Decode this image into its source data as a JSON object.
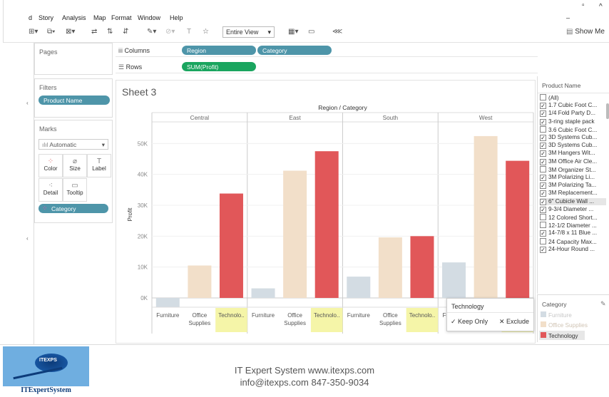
{
  "menu": [
    "d",
    "Story",
    "Analysis",
    "Map",
    "Format",
    "Window",
    "Help"
  ],
  "toolbar": {
    "fit_select": "Entire View",
    "show_me": "Show Me"
  },
  "pages": {
    "title": "Pages"
  },
  "filters": {
    "title": "Filters",
    "pill": "Product Name"
  },
  "marks": {
    "title": "Marks",
    "type": "Automatic",
    "buttons": [
      "Color",
      "Size",
      "Label",
      "Detail",
      "Tooltip"
    ],
    "pill": "Category"
  },
  "shelves": {
    "columns_label": "Columns",
    "rows_label": "Rows",
    "columns": [
      "Region",
      "Category"
    ],
    "rows": [
      "SUM(Profit)"
    ]
  },
  "sheet": {
    "title": "Sheet 3"
  },
  "chart_data": {
    "type": "bar",
    "header": "Region / Category",
    "regions": [
      "Central",
      "East",
      "South",
      "West"
    ],
    "categories": [
      "Furniture",
      "Office Supplies",
      "Technolo.."
    ],
    "category_tick_lines": [
      [
        "Furniture"
      ],
      [
        "Office",
        "Supplies"
      ],
      [
        "Technolo.."
      ]
    ],
    "ylabel": "Profit",
    "yticks": [
      "0K",
      "10K",
      "20K",
      "30K",
      "40K",
      "50K"
    ],
    "ylim": [
      -3000,
      57000
    ],
    "series": [
      {
        "region": "Central",
        "values": [
          -2900,
          10500,
          33800
        ]
      },
      {
        "region": "East",
        "values": [
          3100,
          41200,
          47500
        ]
      },
      {
        "region": "South",
        "values": [
          6900,
          19600,
          20000
        ]
      },
      {
        "region": "West",
        "values": [
          11500,
          52400,
          44400
        ]
      }
    ],
    "colors": {
      "Furniture": "#d3dce3",
      "Office Supplies": "#f2dfc9",
      "Technology": "#e15759"
    },
    "highlight": "#f5f5a8"
  },
  "product_list": {
    "title": "Product Name",
    "items": [
      {
        "label": "(All)",
        "checked": false
      },
      {
        "label": "1.7 Cubic Foot C...",
        "checked": true
      },
      {
        "label": "1/4 Fold Party D...",
        "checked": true
      },
      {
        "label": "3-ring staple pack",
        "checked": true
      },
      {
        "label": "3.6 Cubic Foot C...",
        "checked": false
      },
      {
        "label": "3D Systems Cub...",
        "checked": true
      },
      {
        "label": "3D Systems Cub...",
        "checked": true
      },
      {
        "label": "3M Hangers Wit...",
        "checked": true
      },
      {
        "label": "3M Office Air Cle...",
        "checked": true
      },
      {
        "label": "3M Organizer St...",
        "checked": false
      },
      {
        "label": "3M Polarizing Li...",
        "checked": true
      },
      {
        "label": "3M Polarizing Ta...",
        "checked": true
      },
      {
        "label": "3M Replacement...",
        "checked": true
      },
      {
        "label": "6\" Cubicle Wall ...",
        "checked": true
      },
      {
        "label": "9-3/4 Diameter ...",
        "checked": true
      },
      {
        "label": "12 Colored Short...",
        "checked": false
      },
      {
        "label": "12-1/2 Diameter ...",
        "checked": false
      },
      {
        "label": "14-7/8 x 11 Blue ...",
        "checked": true
      },
      {
        "label": "24 Capacity Max...",
        "checked": false
      },
      {
        "label": "24-Hour Round ...",
        "checked": true
      }
    ]
  },
  "legend": {
    "title": "Category",
    "items": [
      "Furniture",
      "Office Supplies",
      "Technology"
    ]
  },
  "popup": {
    "title": "Technology",
    "keep": "✓ Keep Only",
    "exclude": "✕ Exclude"
  },
  "footer": {
    "line1": "IT Expert System   www.itexps.com",
    "line2": "info@itexps.com  847-350-9034",
    "logo_text": "ITExpertSystem",
    "logo_badge": "ITEXPS"
  }
}
